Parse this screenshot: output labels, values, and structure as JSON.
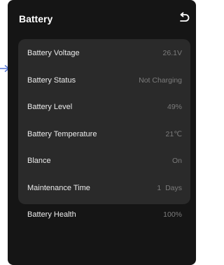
{
  "header": {
    "title": "Battery"
  },
  "colors": {
    "background": "#151515",
    "card": "#2a2a2a",
    "label_text": "#ececec",
    "value_text": "#7c7c7c",
    "pointer_arrow": "#5b7bd8"
  },
  "icons": {
    "back": "back-arrow-icon",
    "pointer": "pointer-arrow-icon"
  },
  "battery_info": {
    "rows": [
      {
        "label": "Battery Voltage",
        "value": "26.1V"
      },
      {
        "label": "Battery Status",
        "value": "Not Charging"
      },
      {
        "label": "Battery Level",
        "value": "49%"
      },
      {
        "label": "Battery Temperature",
        "value": "21℃"
      },
      {
        "label": "Blance",
        "value": "On"
      },
      {
        "label": "Maintenance Time",
        "value": "1  Days"
      },
      {
        "label": "Battery Health",
        "value": "100%"
      }
    ]
  }
}
